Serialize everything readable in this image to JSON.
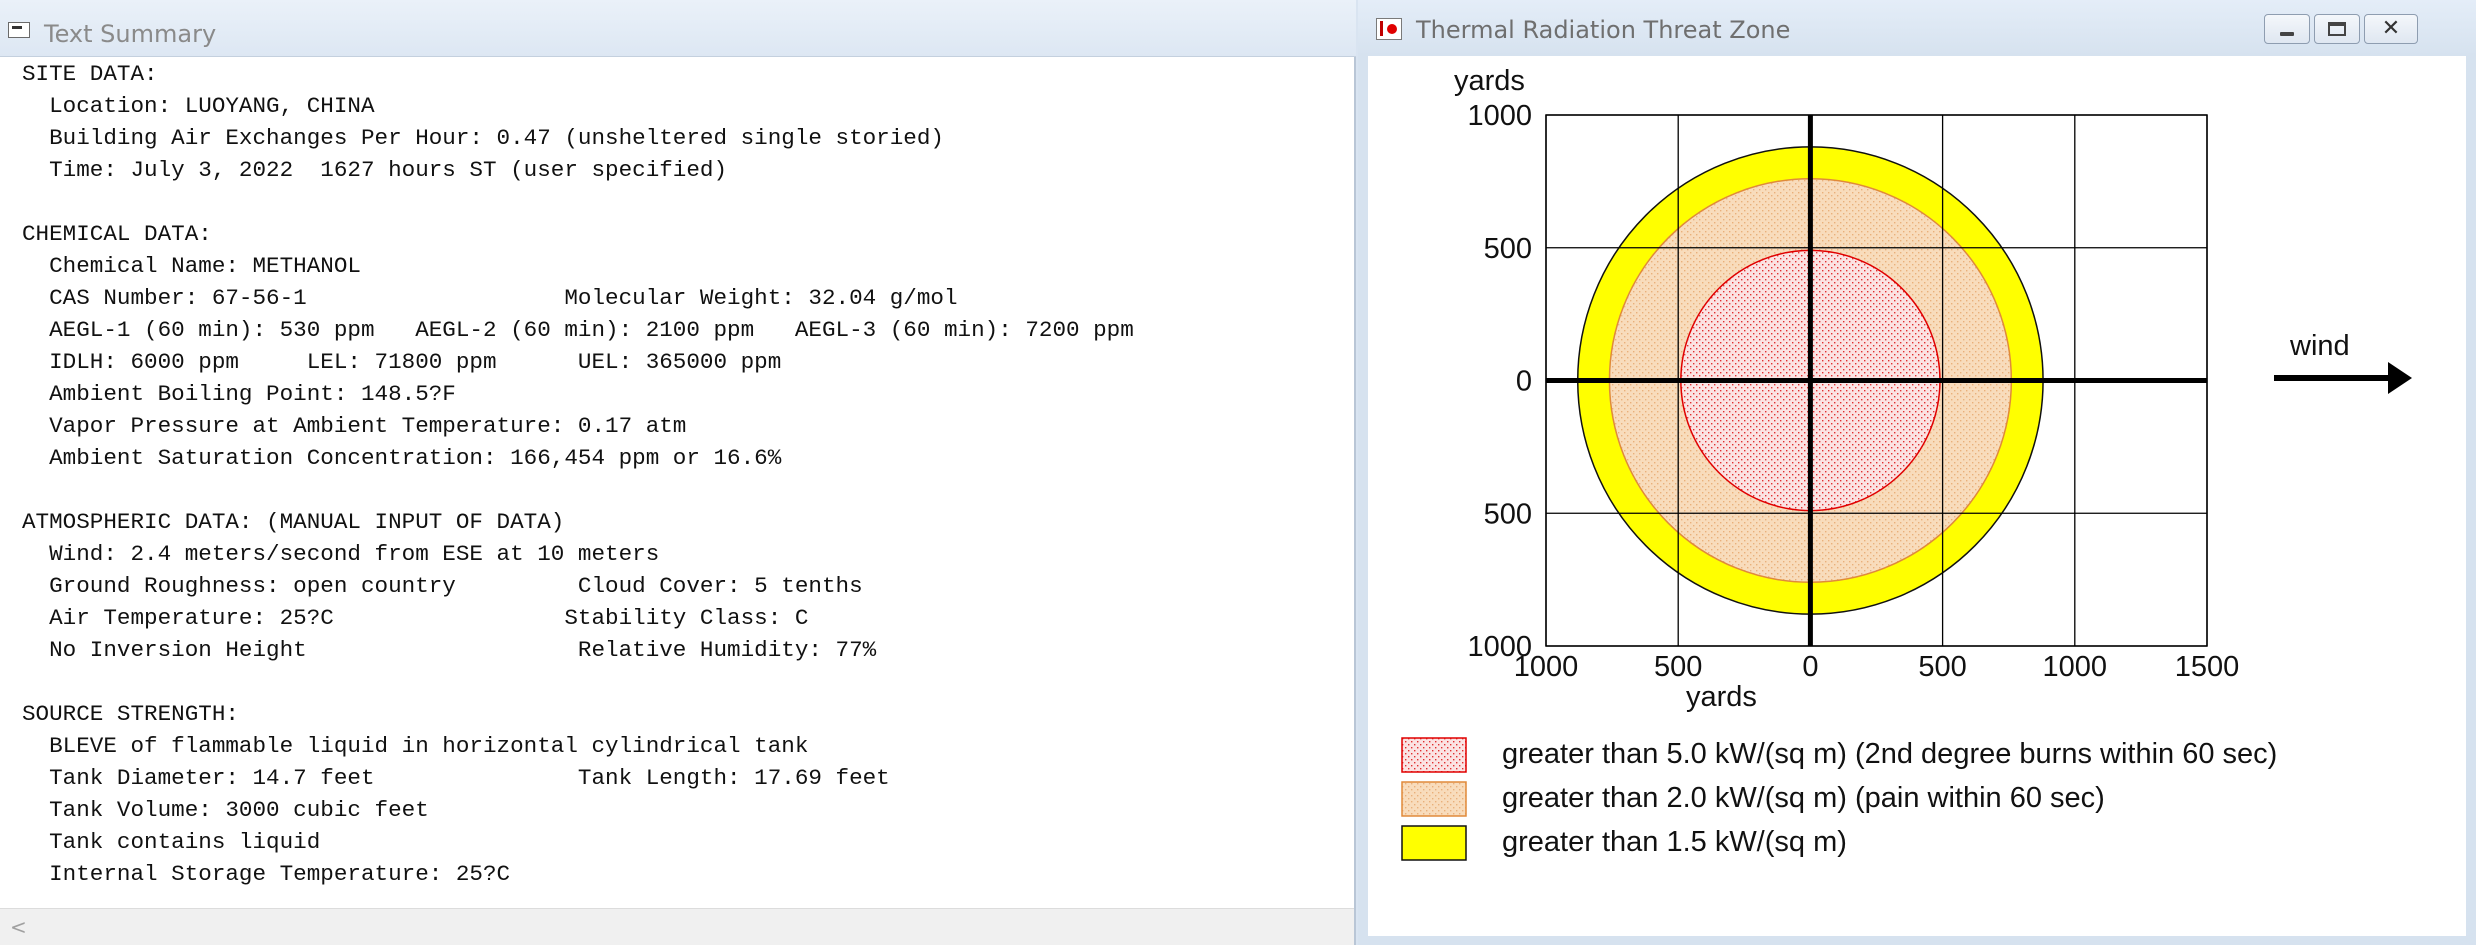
{
  "left_window": {
    "title": "Text Summary",
    "lines": [
      "SITE DATA:",
      "  Location: LUOYANG, CHINA",
      "  Building Air Exchanges Per Hour: 0.47 (unsheltered single storied)",
      "  Time: July 3, 2022  1627 hours ST (user specified)",
      "",
      "CHEMICAL DATA:",
      "  Chemical Name: METHANOL",
      "  CAS Number: 67-56-1                   Molecular Weight: 32.04 g/mol",
      "  AEGL-1 (60 min): 530 ppm   AEGL-2 (60 min): 2100 ppm   AEGL-3 (60 min): 7200 ppm",
      "  IDLH: 6000 ppm     LEL: 71800 ppm      UEL: 365000 ppm",
      "  Ambient Boiling Point: 148.5?F",
      "  Vapor Pressure at Ambient Temperature: 0.17 atm",
      "  Ambient Saturation Concentration: 166,454 ppm or 16.6%",
      "",
      "ATMOSPHERIC DATA: (MANUAL INPUT OF DATA)",
      "  Wind: 2.4 meters/second from ESE at 10 meters",
      "  Ground Roughness: open country         Cloud Cover: 5 tenths",
      "  Air Temperature: 25?C                 Stability Class: C",
      "  No Inversion Height                    Relative Humidity: 77%",
      "",
      "SOURCE STRENGTH:",
      "  BLEVE of flammable liquid in horizontal cylindrical tank",
      "  Tank Diameter: 14.7 feet               Tank Length: 17.69 feet",
      "  Tank Volume: 3000 cubic feet",
      "  Tank contains liquid",
      "  Internal Storage Temperature: 25?C"
    ],
    "scroll_left_glyph": "<"
  },
  "right_window": {
    "title": "Thermal Radiation Threat Zone",
    "buttons": {
      "minimize": "minimize",
      "maximize": "maximize",
      "close": "✕"
    }
  },
  "chart_data": {
    "type": "threat-zone",
    "ylabel": "yards",
    "xlabel": "yards",
    "x_ticks": [
      "1000",
      "500",
      "0",
      "500",
      "1000",
      "1500"
    ],
    "x_tick_values": [
      -1000,
      -500,
      0,
      500,
      1000,
      1500
    ],
    "y_ticks": [
      "1000",
      "500",
      "0",
      "500",
      "1000"
    ],
    "y_tick_values": [
      1000,
      500,
      0,
      -500,
      -1000
    ],
    "xlim": [
      -1000,
      1500
    ],
    "ylim": [
      -1000,
      1000
    ],
    "grid": true,
    "wind_label": "wind",
    "wind_direction": "east",
    "zones": [
      {
        "name": "greater than 5.0 kW/(sq m) (2nd degree burns within 60 sec)",
        "radius": 490,
        "fill": "#fbe3e3",
        "dot": "#e03030",
        "stroke": "#e00000",
        "pattern": "dots"
      },
      {
        "name": "greater than 2.0 kW/(sq m) (pain within 60 sec)",
        "radius": 760,
        "fill": "#f8dcbc",
        "dot": "#e9b07a",
        "stroke": "#e08a3a",
        "pattern": "dots"
      },
      {
        "name": "greater than 1.5 kW/(sq m)",
        "radius": 880,
        "fill": "#ffff00",
        "dot": "",
        "stroke": "#111111",
        "pattern": "solid"
      }
    ]
  }
}
